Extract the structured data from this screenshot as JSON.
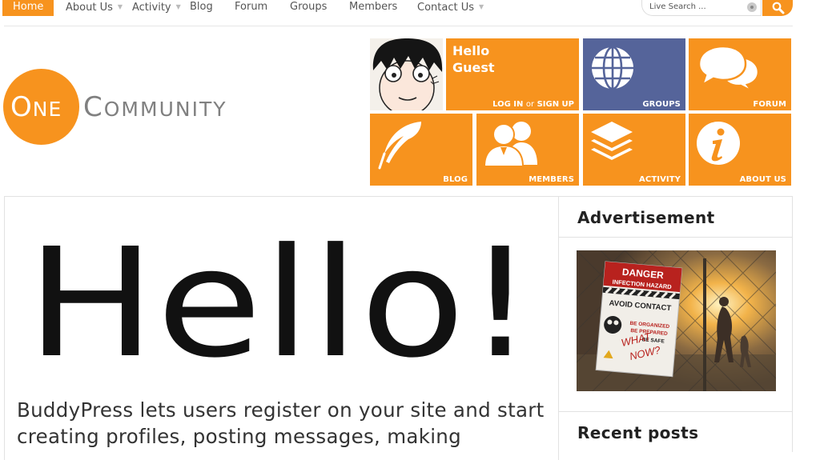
{
  "nav": {
    "items": [
      {
        "label": "Home"
      },
      {
        "label": "About Us"
      },
      {
        "label": "Activity"
      },
      {
        "label": "Blog"
      },
      {
        "label": "Forum"
      },
      {
        "label": "Groups"
      },
      {
        "label": "Members"
      },
      {
        "label": "Contact Us"
      }
    ],
    "search_placeholder": "Live Search ..."
  },
  "logo": {
    "one_first": "O",
    "one_rest": "NE",
    "community_first": "C",
    "community_rest": "OMMUNITY"
  },
  "tiles": {
    "hello": {
      "line1": "Hello",
      "line2": "Guest"
    },
    "login": "LOG IN",
    "or": "or",
    "signup": "SIGN UP",
    "groups": "GROUPS",
    "forum": "FORUM",
    "blog": "BLOG",
    "members": "MEMBERS",
    "activity": "ACTIVITY",
    "about": "ABOUT US"
  },
  "main": {
    "headline": "Hello!",
    "intro": "BuddyPress lets users register on your site and start creating profiles, posting messages, making"
  },
  "sidebar": {
    "advertisement_title": "Advertisement",
    "recent_posts_title": "Recent posts",
    "ad": {
      "sign_danger": "DANGER",
      "sign_hazard": "INFECTION HAZARD",
      "sign_avoid": "AVOID CONTACT",
      "sign_organized": "BE ORGANIZED",
      "sign_prepared": "BE PREPARED",
      "sign_safe": "BE SAFE",
      "sign_what": "WHAT",
      "sign_now": "NOW?"
    }
  },
  "colors": {
    "accent": "#f7931e",
    "tile_blue": "#55649a",
    "logo_gray": "#808080"
  },
  "icons": {
    "search": "magnifier-icon",
    "groups": "globe-icon",
    "forum": "speech-bubbles-icon",
    "blog": "feather-icon",
    "members": "people-icon",
    "activity": "layers-icon",
    "about": "info-icon"
  }
}
